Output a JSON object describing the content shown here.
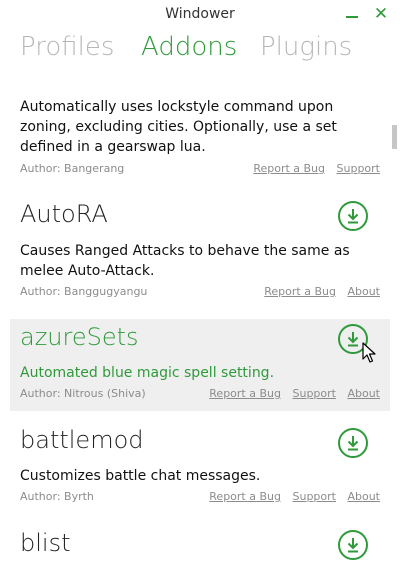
{
  "window": {
    "title": "Windower",
    "minimize_icon": "minimize-icon",
    "close_icon": "close-icon",
    "close_glyph": "✕"
  },
  "tabs": [
    {
      "label": "Profiles",
      "active": false
    },
    {
      "label": "Addons",
      "active": true
    },
    {
      "label": "Plugins",
      "active": false
    }
  ],
  "colors": {
    "accent": "#2e9a3a",
    "muted": "#b7b7b7",
    "hover_bg": "#efefef"
  },
  "addons": [
    {
      "name": "",
      "description": "Automatically uses lockstyle command upon zoning, excluding cities. Optionally, use a set defined in a gearswap lua.",
      "author": "Author: Bangerang",
      "report_label": "Report a Bug",
      "support_label": "Support",
      "about_label": ""
    },
    {
      "name": "AutoRA",
      "description": "Causes Ranged Attacks to behave the same as melee Auto-Attack.",
      "author": "Author: Banggugyangu",
      "report_label": "Report a Bug",
      "support_label": "",
      "about_label": "About"
    },
    {
      "name": "azureSets",
      "description": "Automated blue magic spell setting.",
      "author": "Author: Nitrous (Shiva)",
      "report_label": "Report a Bug",
      "support_label": "Support",
      "about_label": "About"
    },
    {
      "name": "battlemod",
      "description": "Customizes battle chat messages.",
      "author": "Author: Byrth",
      "report_label": "Report a Bug",
      "support_label": "Support",
      "about_label": "About"
    },
    {
      "name": "blist",
      "description": "",
      "author": "",
      "report_label": "",
      "support_label": "",
      "about_label": ""
    }
  ]
}
